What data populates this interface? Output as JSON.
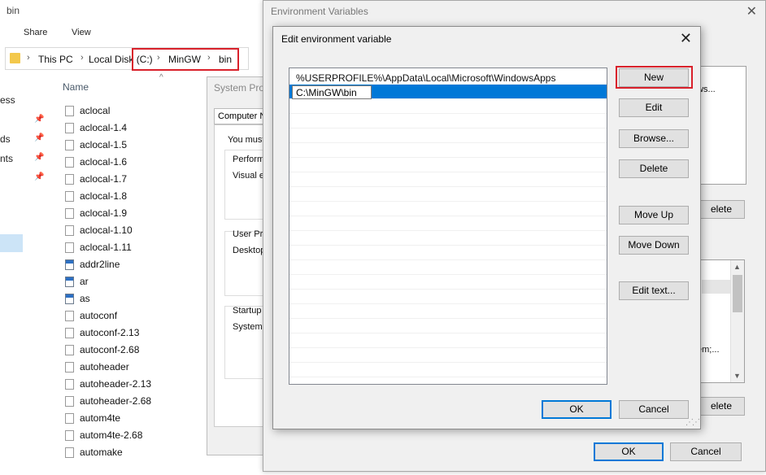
{
  "explorer": {
    "title": "bin",
    "menu": [
      "Share",
      "View"
    ],
    "breadcrumb": [
      "This PC",
      "Local Disk (C:)",
      "MinGW",
      "bin"
    ],
    "nav_items": [
      "ess",
      "ds",
      "nts"
    ],
    "column_header": "Name",
    "files": [
      {
        "name": "aclocal",
        "type": "doc"
      },
      {
        "name": "aclocal-1.4",
        "type": "doc"
      },
      {
        "name": "aclocal-1.5",
        "type": "doc"
      },
      {
        "name": "aclocal-1.6",
        "type": "doc"
      },
      {
        "name": "aclocal-1.7",
        "type": "doc"
      },
      {
        "name": "aclocal-1.8",
        "type": "doc"
      },
      {
        "name": "aclocal-1.9",
        "type": "doc"
      },
      {
        "name": "aclocal-1.10",
        "type": "doc"
      },
      {
        "name": "aclocal-1.11",
        "type": "doc"
      },
      {
        "name": "addr2line",
        "type": "app"
      },
      {
        "name": "ar",
        "type": "app"
      },
      {
        "name": "as",
        "type": "app"
      },
      {
        "name": "autoconf",
        "type": "doc"
      },
      {
        "name": "autoconf-2.13",
        "type": "doc"
      },
      {
        "name": "autoconf-2.68",
        "type": "doc"
      },
      {
        "name": "autoheader",
        "type": "doc"
      },
      {
        "name": "autoheader-2.13",
        "type": "doc"
      },
      {
        "name": "autoheader-2.68",
        "type": "doc"
      },
      {
        "name": "autom4te",
        "type": "doc"
      },
      {
        "name": "autom4te-2.68",
        "type": "doc"
      },
      {
        "name": "automake",
        "type": "doc"
      }
    ]
  },
  "system_properties": {
    "title": "System Prop",
    "tab": "Computer N",
    "lines": [
      "You must",
      "Performa",
      "Visual ef",
      "User Pro",
      "Desktop",
      "Startup a",
      "System s"
    ]
  },
  "env_vars": {
    "title": "Environment Variables",
    "fragments": [
      "ows...",
      "elete",
      "em;...",
      "elete"
    ],
    "ok_label": "OK",
    "cancel_label": "Cancel"
  },
  "edit_dialog": {
    "title": "Edit environment variable",
    "paths": [
      "%USERPROFILE%\\AppData\\Local\\Microsoft\\WindowsApps"
    ],
    "editing_value": "C:\\MinGW\\bin",
    "buttons": {
      "new": "New",
      "edit": "Edit",
      "browse": "Browse...",
      "delete": "Delete",
      "move_up": "Move Up",
      "move_down": "Move Down",
      "edit_text": "Edit text..."
    },
    "ok_label": "OK",
    "cancel_label": "Cancel"
  },
  "colors": {
    "highlight_red": "#d9212b",
    "selection_blue": "#0078d7",
    "folder_yellow": "#f3c84b"
  }
}
